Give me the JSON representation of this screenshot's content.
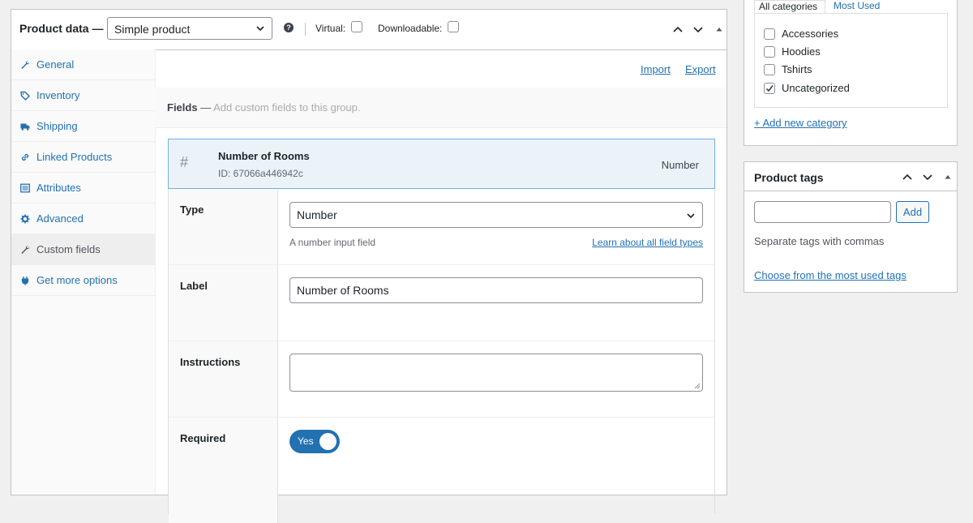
{
  "product_data": {
    "title": "Product data —",
    "product_type": "Simple product",
    "help_icon_glyph": "?",
    "virtual_label": "Virtual:",
    "downloadable_label": "Downloadable:",
    "virtual_checked": false,
    "downloadable_checked": false
  },
  "tabs": [
    {
      "label": "General",
      "icon": "wrench-icon"
    },
    {
      "label": "Inventory",
      "icon": "tag-icon"
    },
    {
      "label": "Shipping",
      "icon": "truck-icon"
    },
    {
      "label": "Linked Products",
      "icon": "link-icon"
    },
    {
      "label": "Attributes",
      "icon": "list-icon"
    },
    {
      "label": "Advanced",
      "icon": "gear-icon"
    },
    {
      "label": "Custom fields",
      "icon": "wrench-icon",
      "active": true
    },
    {
      "label": "Get more options",
      "icon": "plugin-icon"
    }
  ],
  "toolbar": {
    "import_label": "Import",
    "export_label": "Export"
  },
  "fields_bar": {
    "title": "Fields",
    "separator": " — ",
    "description": "Add custom fields to this group."
  },
  "field": {
    "hash": "#",
    "name": "Number of Rooms",
    "id_text": "ID: 67066a446942c",
    "type_label": "Number"
  },
  "settings": {
    "type_label": "Type",
    "type_value": "Number",
    "type_hint": "A number input field",
    "learn_link": "Learn about all field types",
    "label_label": "Label",
    "label_value": "Number of Rooms",
    "instructions_label": "Instructions",
    "instructions_value": "",
    "required_label": "Required",
    "required_toggle": "Yes",
    "required_on": true
  },
  "categories": {
    "tab_all": "All categories",
    "tab_most_used": "Most Used",
    "items": [
      {
        "label": "Accessories",
        "checked": false
      },
      {
        "label": "Hoodies",
        "checked": false
      },
      {
        "label": "Tshirts",
        "checked": false
      },
      {
        "label": "Uncategorized",
        "checked": true
      }
    ],
    "add_new": "+ Add new category"
  },
  "tags": {
    "title": "Product tags",
    "input_value": "",
    "add_button": "Add",
    "hint": "Separate tags with commas",
    "choose_link": "Choose from the most used tags"
  },
  "colors": {
    "accent": "#2271b1",
    "field_highlight": "#ebf3f9",
    "border": "#c3c4c7"
  }
}
